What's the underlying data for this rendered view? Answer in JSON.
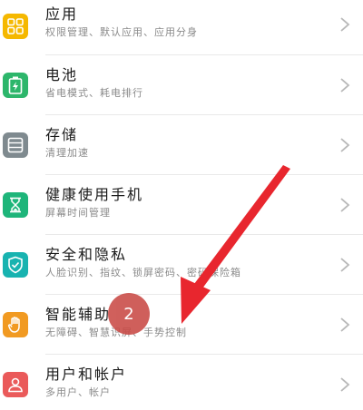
{
  "settings_items": [
    {
      "id": "apps",
      "title": "应用",
      "subtitle": "权限管理、默认应用、应用分身",
      "icon": "apps-grid-icon",
      "color": "#f5b800"
    },
    {
      "id": "battery",
      "title": "电池",
      "subtitle": "省电模式、耗电排行",
      "icon": "battery-icon",
      "color": "#2db66b"
    },
    {
      "id": "storage",
      "title": "存储",
      "subtitle": "清理加速",
      "icon": "storage-icon",
      "color": "#7f8a8f"
    },
    {
      "id": "digital-balance",
      "title": "健康使用手机",
      "subtitle": "屏幕时间管理",
      "icon": "hourglass-icon",
      "color": "#1eb57a"
    },
    {
      "id": "security",
      "title": "安全和隐私",
      "subtitle": "人脸识别、指纹、锁屏密码、密码保险箱",
      "icon": "shield-icon",
      "color": "#18b3b0"
    },
    {
      "id": "accessibility",
      "title": "智能辅助",
      "subtitle": "无障碍、智慧识屏、手势控制",
      "icon": "hand-icon",
      "color": "#f19a22"
    },
    {
      "id": "users",
      "title": "用户和帐户",
      "subtitle": "多用户、帐户",
      "icon": "user-icon",
      "color": "#ea5a5a"
    }
  ],
  "annotation": {
    "step_label": "2"
  }
}
